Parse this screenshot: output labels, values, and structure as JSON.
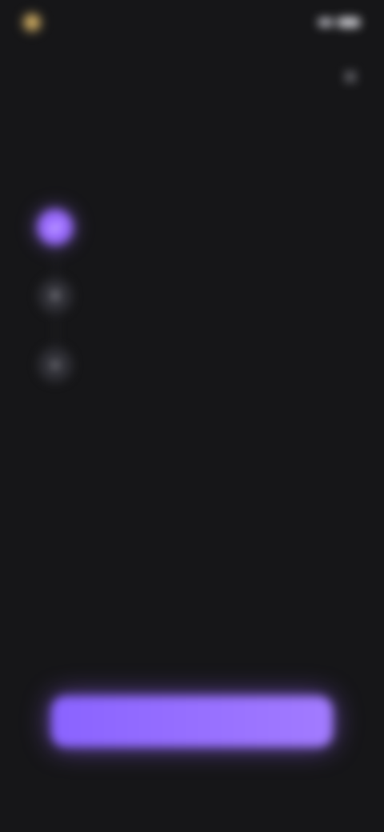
{
  "status": {
    "time": ""
  },
  "close": {
    "icon": "close-icon"
  },
  "header": {
    "eyebrow": "",
    "title": ""
  },
  "steps": [
    {
      "title": "",
      "description": "",
      "icon": "check-icon",
      "active": true
    },
    {
      "title": "",
      "description": "",
      "icon": "bell-icon",
      "active": false
    },
    {
      "title": "",
      "description": "",
      "icon": "star-icon",
      "active": false
    }
  ],
  "footer": {
    "note": "",
    "primary_label": "",
    "secondary_label": ""
  },
  "colors": {
    "background": "#161618",
    "accent": "#9a6bff"
  }
}
